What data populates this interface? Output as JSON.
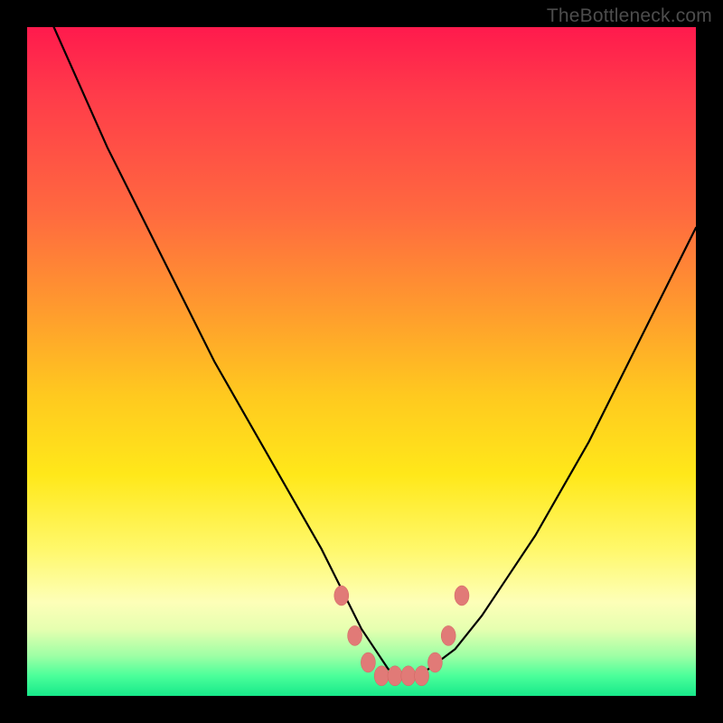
{
  "watermark": "TheBottleneck.com",
  "colors": {
    "gradient_top": "#ff1a4d",
    "gradient_mid1": "#ff9a2e",
    "gradient_mid2": "#ffe81a",
    "gradient_bottom": "#17e88a",
    "curve": "#000000",
    "marker": "#e17a77",
    "frame": "#000000"
  },
  "chart_data": {
    "type": "line",
    "title": "",
    "xlabel": "",
    "ylabel": "",
    "xlim": [
      0,
      100
    ],
    "ylim": [
      0,
      100
    ],
    "grid": false,
    "series": [
      {
        "name": "bottleneck-curve",
        "x": [
          4,
          8,
          12,
          16,
          20,
          24,
          28,
          32,
          36,
          40,
          44,
          48,
          50,
          52,
          54,
          56,
          58,
          60,
          64,
          68,
          72,
          76,
          80,
          84,
          88,
          92,
          96,
          100
        ],
        "y": [
          100,
          91,
          82,
          74,
          66,
          58,
          50,
          43,
          36,
          29,
          22,
          14,
          10,
          7,
          4,
          3,
          3,
          4,
          7,
          12,
          18,
          24,
          31,
          38,
          46,
          54,
          62,
          70
        ]
      }
    ],
    "markers": [
      {
        "x": 47,
        "y": 15
      },
      {
        "x": 49,
        "y": 9
      },
      {
        "x": 51,
        "y": 5
      },
      {
        "x": 53,
        "y": 3
      },
      {
        "x": 55,
        "y": 3
      },
      {
        "x": 57,
        "y": 3
      },
      {
        "x": 59,
        "y": 3
      },
      {
        "x": 61,
        "y": 5
      },
      {
        "x": 63,
        "y": 9
      },
      {
        "x": 65,
        "y": 15
      }
    ]
  }
}
